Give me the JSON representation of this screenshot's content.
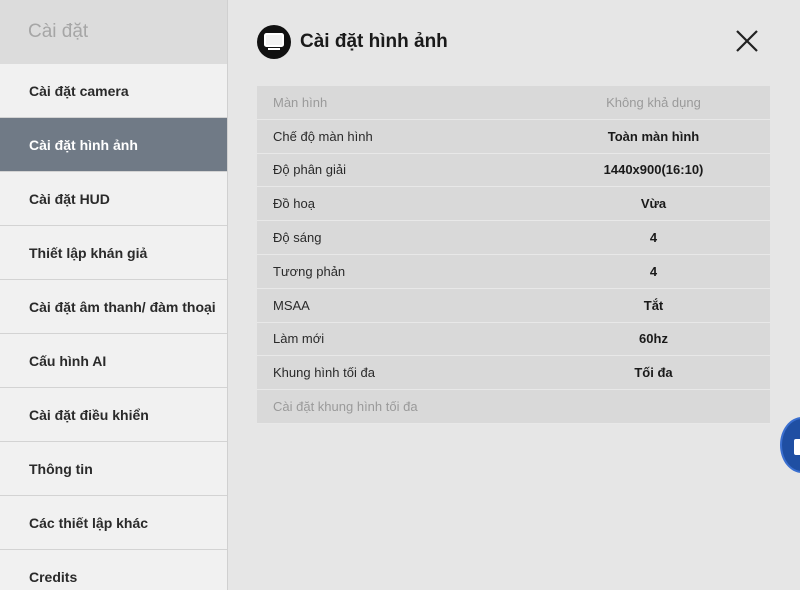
{
  "sidebar": {
    "title": "Cài đặt",
    "items": [
      {
        "label": "Cài đặt camera"
      },
      {
        "label": "Cài đặt hình ảnh",
        "active": true
      },
      {
        "label": "Cài đặt HUD"
      },
      {
        "label": "Thiết lập khán giả"
      },
      {
        "label": "Cài đặt âm thanh/ đàm thoại"
      },
      {
        "label": "Cấu hình AI"
      },
      {
        "label": "Cài đặt điều khiển"
      },
      {
        "label": "Thông tin"
      },
      {
        "label": "Các thiết lập khác"
      },
      {
        "label": "Credits"
      }
    ]
  },
  "main": {
    "title": "Cài đặt hình ảnh",
    "title_icon": "monitor-icon",
    "close_icon": "close-icon",
    "settings": [
      {
        "label": "Màn hình",
        "value": "Không khả dụng",
        "disabled": true
      },
      {
        "label": "Chế độ màn hình",
        "value": "Toàn màn hình"
      },
      {
        "label": "Độ phân giải",
        "value": "1440x900(16:10)"
      },
      {
        "label": "Đồ hoạ",
        "value": "Vừa"
      },
      {
        "label": "Độ sáng",
        "value": "4"
      },
      {
        "label": "Tương phản",
        "value": "4"
      },
      {
        "label": "MSAA",
        "value": "Tắt"
      },
      {
        "label": "Làm mới",
        "value": "60hz"
      },
      {
        "label": "Khung hình tối đa",
        "value": "Tối đa"
      },
      {
        "label": "Cài đặt khung hình tối đa",
        "value": "",
        "disabled": true
      }
    ]
  },
  "colors": {
    "active_sidebar": "#707a86",
    "row_background": "#d9d9d9",
    "disabled_text": "#9a9a9a"
  }
}
